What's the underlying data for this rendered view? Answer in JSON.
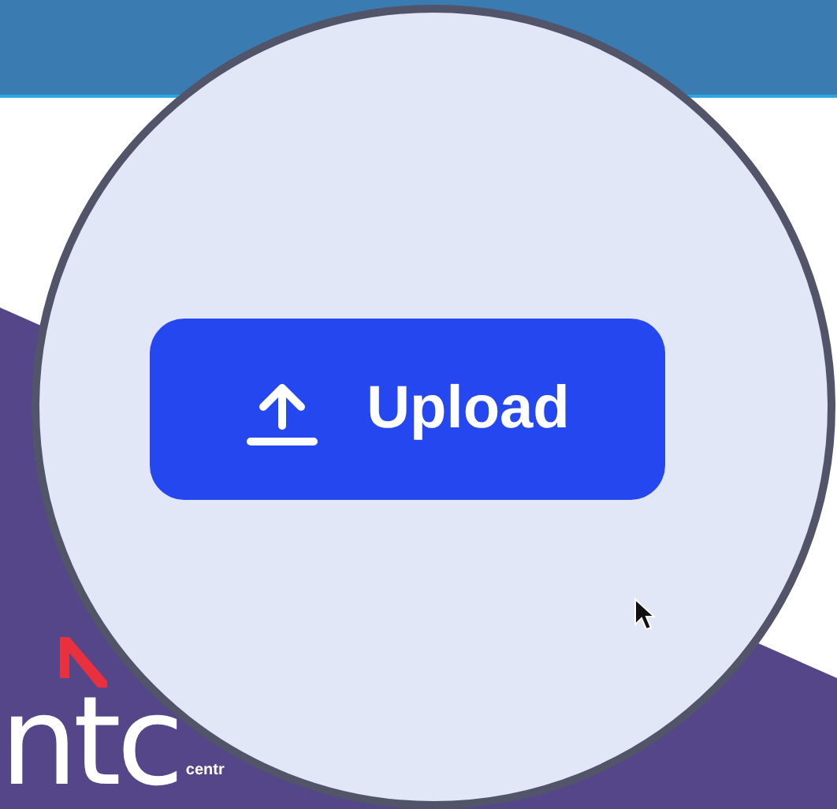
{
  "logo": {
    "wordmark": "ntc",
    "tagline": "centr"
  },
  "magnifier": {
    "button": {
      "label": "Upload"
    }
  }
}
